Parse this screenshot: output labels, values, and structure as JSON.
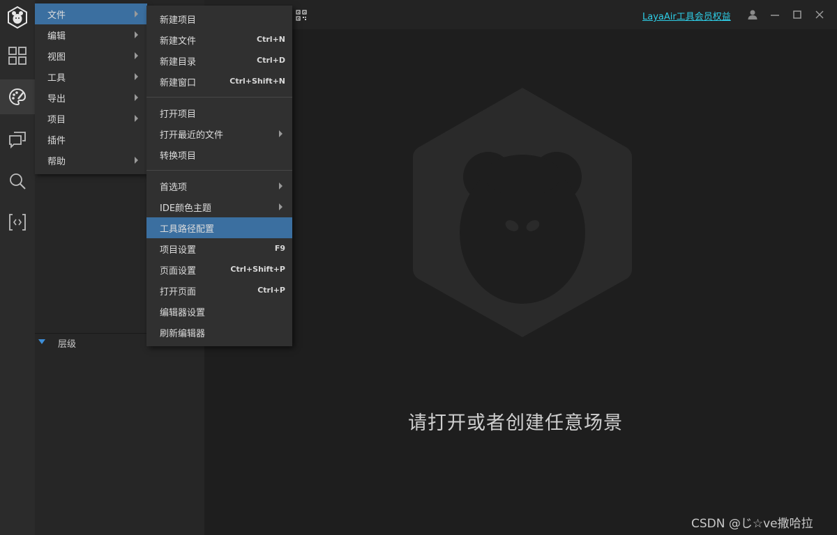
{
  "colors": {
    "accent": "#3b6fa0",
    "link": "#2ecde6",
    "background": "#1e1e1e",
    "panel": "#262626"
  },
  "activity_bar": {
    "items": [
      {
        "icon": "app-logo-icon"
      },
      {
        "icon": "grid-icon"
      },
      {
        "icon": "palette-icon"
      },
      {
        "icon": "chat-icon"
      },
      {
        "icon": "search-icon"
      },
      {
        "icon": "code-brackets-icon"
      }
    ]
  },
  "titlebar": {
    "member_link": "LayaAir工具会员权益"
  },
  "main_menu": {
    "items": [
      {
        "label": "文件",
        "has_submenu": true
      },
      {
        "label": "编辑",
        "has_submenu": true
      },
      {
        "label": "视图",
        "has_submenu": true
      },
      {
        "label": "工具",
        "has_submenu": true
      },
      {
        "label": "导出",
        "has_submenu": true
      },
      {
        "label": "项目",
        "has_submenu": true
      },
      {
        "label": "插件",
        "has_submenu": false
      },
      {
        "label": "帮助",
        "has_submenu": true
      }
    ]
  },
  "file_menu": {
    "items": [
      {
        "label": "新建项目",
        "shortcut": ""
      },
      {
        "label": "新建文件",
        "shortcut": "Ctrl+N"
      },
      {
        "label": "新建目录",
        "shortcut": "Ctrl+D"
      },
      {
        "label": "新建窗口",
        "shortcut": "Ctrl+Shift+N"
      },
      {
        "label": "打开项目",
        "shortcut": ""
      },
      {
        "label": "打开最近的文件",
        "shortcut": ""
      },
      {
        "label": "转换项目",
        "shortcut": ""
      },
      {
        "label": "首选项",
        "shortcut": ""
      },
      {
        "label": "IDE颜色主题",
        "shortcut": ""
      },
      {
        "label": "工具路径配置",
        "shortcut": ""
      },
      {
        "label": "项目设置",
        "shortcut": "F9"
      },
      {
        "label": "页面设置",
        "shortcut": "Ctrl+Shift+P"
      },
      {
        "label": "打开页面",
        "shortcut": "Ctrl+P"
      },
      {
        "label": "编辑器设置",
        "shortcut": ""
      },
      {
        "label": "刷新编辑器",
        "shortcut": ""
      }
    ]
  },
  "layer_panel": {
    "title": "层级"
  },
  "main": {
    "empty_message": "请打开或者创建任意场景"
  },
  "watermark": "CSDN @じ☆ve撒哈拉"
}
